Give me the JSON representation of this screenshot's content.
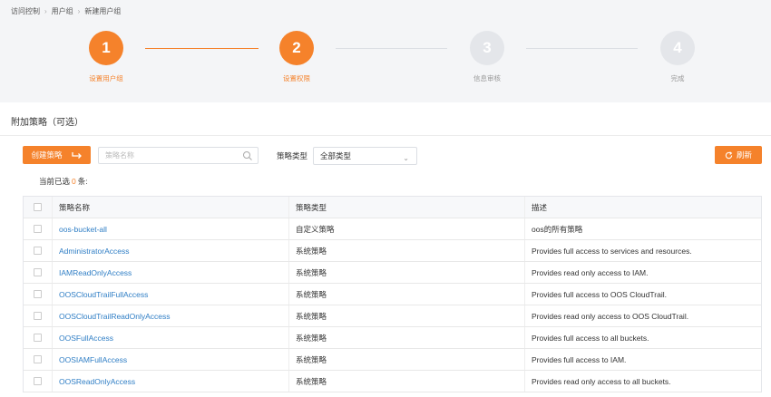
{
  "breadcrumb": [
    "访问控制",
    "用户组",
    "新建用户组"
  ],
  "steps": [
    {
      "number": "1",
      "label": "设置用户组",
      "state": "active"
    },
    {
      "number": "2",
      "label": "设置权限",
      "state": "active"
    },
    {
      "number": "3",
      "label": "信息审核",
      "state": "pending"
    },
    {
      "number": "4",
      "label": "完成",
      "state": "pending"
    }
  ],
  "panel": {
    "title": "附加策略（可选）",
    "create_label": "创建策略",
    "search_placeholder": "策略名称",
    "type_label": "策略类型",
    "type_value": "全部类型",
    "refresh_label": "刷新",
    "selected_prefix": "当前已选",
    "selected_count": "0",
    "selected_suffix": "条:"
  },
  "table": {
    "columns": {
      "name": "策略名称",
      "type": "策略类型",
      "desc": "描述"
    },
    "rows": [
      {
        "name": "oos-bucket-all",
        "type": "自定义策略",
        "desc": "oos的所有策略"
      },
      {
        "name": "AdministratorAccess",
        "type": "系统策略",
        "desc": "Provides full access to services and resources."
      },
      {
        "name": "IAMReadOnlyAccess",
        "type": "系统策略",
        "desc": "Provides read only access to IAM."
      },
      {
        "name": "OOSCloudTrailFullAccess",
        "type": "系统策略",
        "desc": "Provides full access to OOS CloudTrail."
      },
      {
        "name": "OOSCloudTrailReadOnlyAccess",
        "type": "系统策略",
        "desc": "Provides read only access to OOS CloudTrail."
      },
      {
        "name": "OOSFullAccess",
        "type": "系统策略",
        "desc": "Provides full access to all buckets."
      },
      {
        "name": "OOSIAMFullAccess",
        "type": "系统策略",
        "desc": "Provides full access to IAM."
      },
      {
        "name": "OOSReadOnlyAccess",
        "type": "系统策略",
        "desc": "Provides read only access to all buckets."
      }
    ]
  },
  "colors": {
    "accent": "#f5822b",
    "link": "#2f7ec5",
    "pending": "#e4e6ea"
  },
  "icons": {
    "create": "return-arrow-icon",
    "search": "search-icon",
    "refresh": "refresh-icon",
    "select": "chevron-down-icon"
  }
}
